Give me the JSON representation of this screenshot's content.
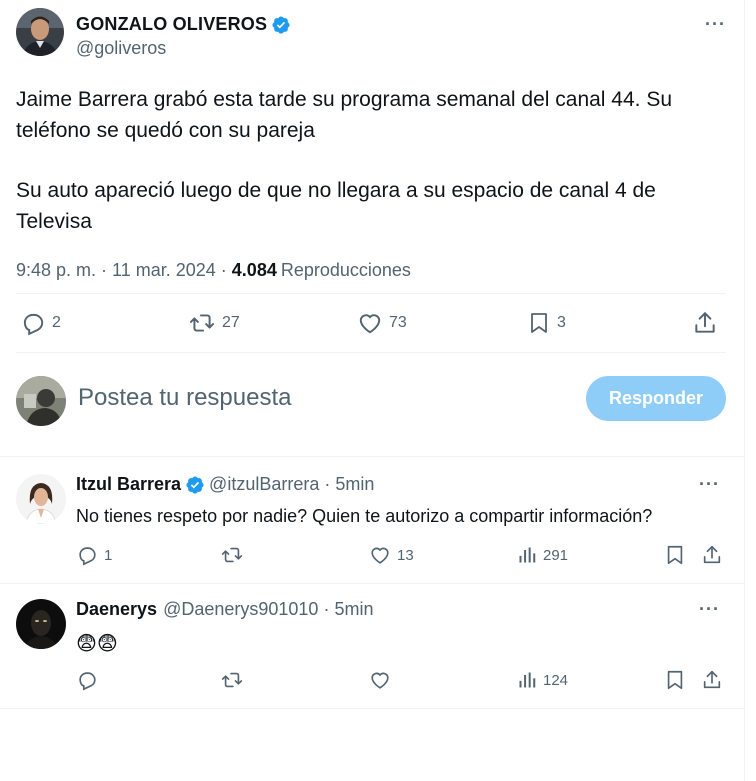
{
  "tweet": {
    "display_name": "GONZALO OLIVEROS",
    "handle": "@goliveros",
    "paragraphs": [
      "Jaime Barrera grabó esta tarde su programa semanal del canal 44. Su teléfono se quedó con su pareja",
      "Su auto apareció luego de que no llegara a su espacio de canal 4 de Televisa"
    ],
    "time": "9:48 p. m.",
    "date": "11 mar. 2024",
    "views_count": "4.084",
    "views_label": "Reproducciones",
    "separator": "·",
    "more_label": "···",
    "actions": {
      "replies": "2",
      "retweets": "27",
      "likes": "73",
      "bookmarks": "3"
    }
  },
  "composer": {
    "placeholder": "Postea tu respuesta",
    "button_label": "Responder"
  },
  "replies": [
    {
      "display_name": "Itzul Barrera",
      "handle": "@itzulBarrera",
      "time": "5min",
      "text": "No tienes respeto por nadie? Quien te autorizo a compartir información?",
      "replies": "1",
      "retweets": "",
      "likes": "13",
      "views": "291"
    },
    {
      "display_name": "Daenerys",
      "handle": "@Daenerys901010",
      "time": "5min",
      "text": "😨😨",
      "replies": "",
      "retweets": "",
      "likes": "",
      "views": "124"
    }
  ],
  "colors": {
    "verified": "#1d9bf0",
    "secondary_text": "#536471",
    "button_disabled": "#8ecdf7",
    "divider": "#eff3f4"
  },
  "icons": [
    "verified-badge-icon",
    "more-icon",
    "reply-icon",
    "retweet-icon",
    "like-icon",
    "bookmark-icon",
    "share-icon",
    "views-icon"
  ]
}
